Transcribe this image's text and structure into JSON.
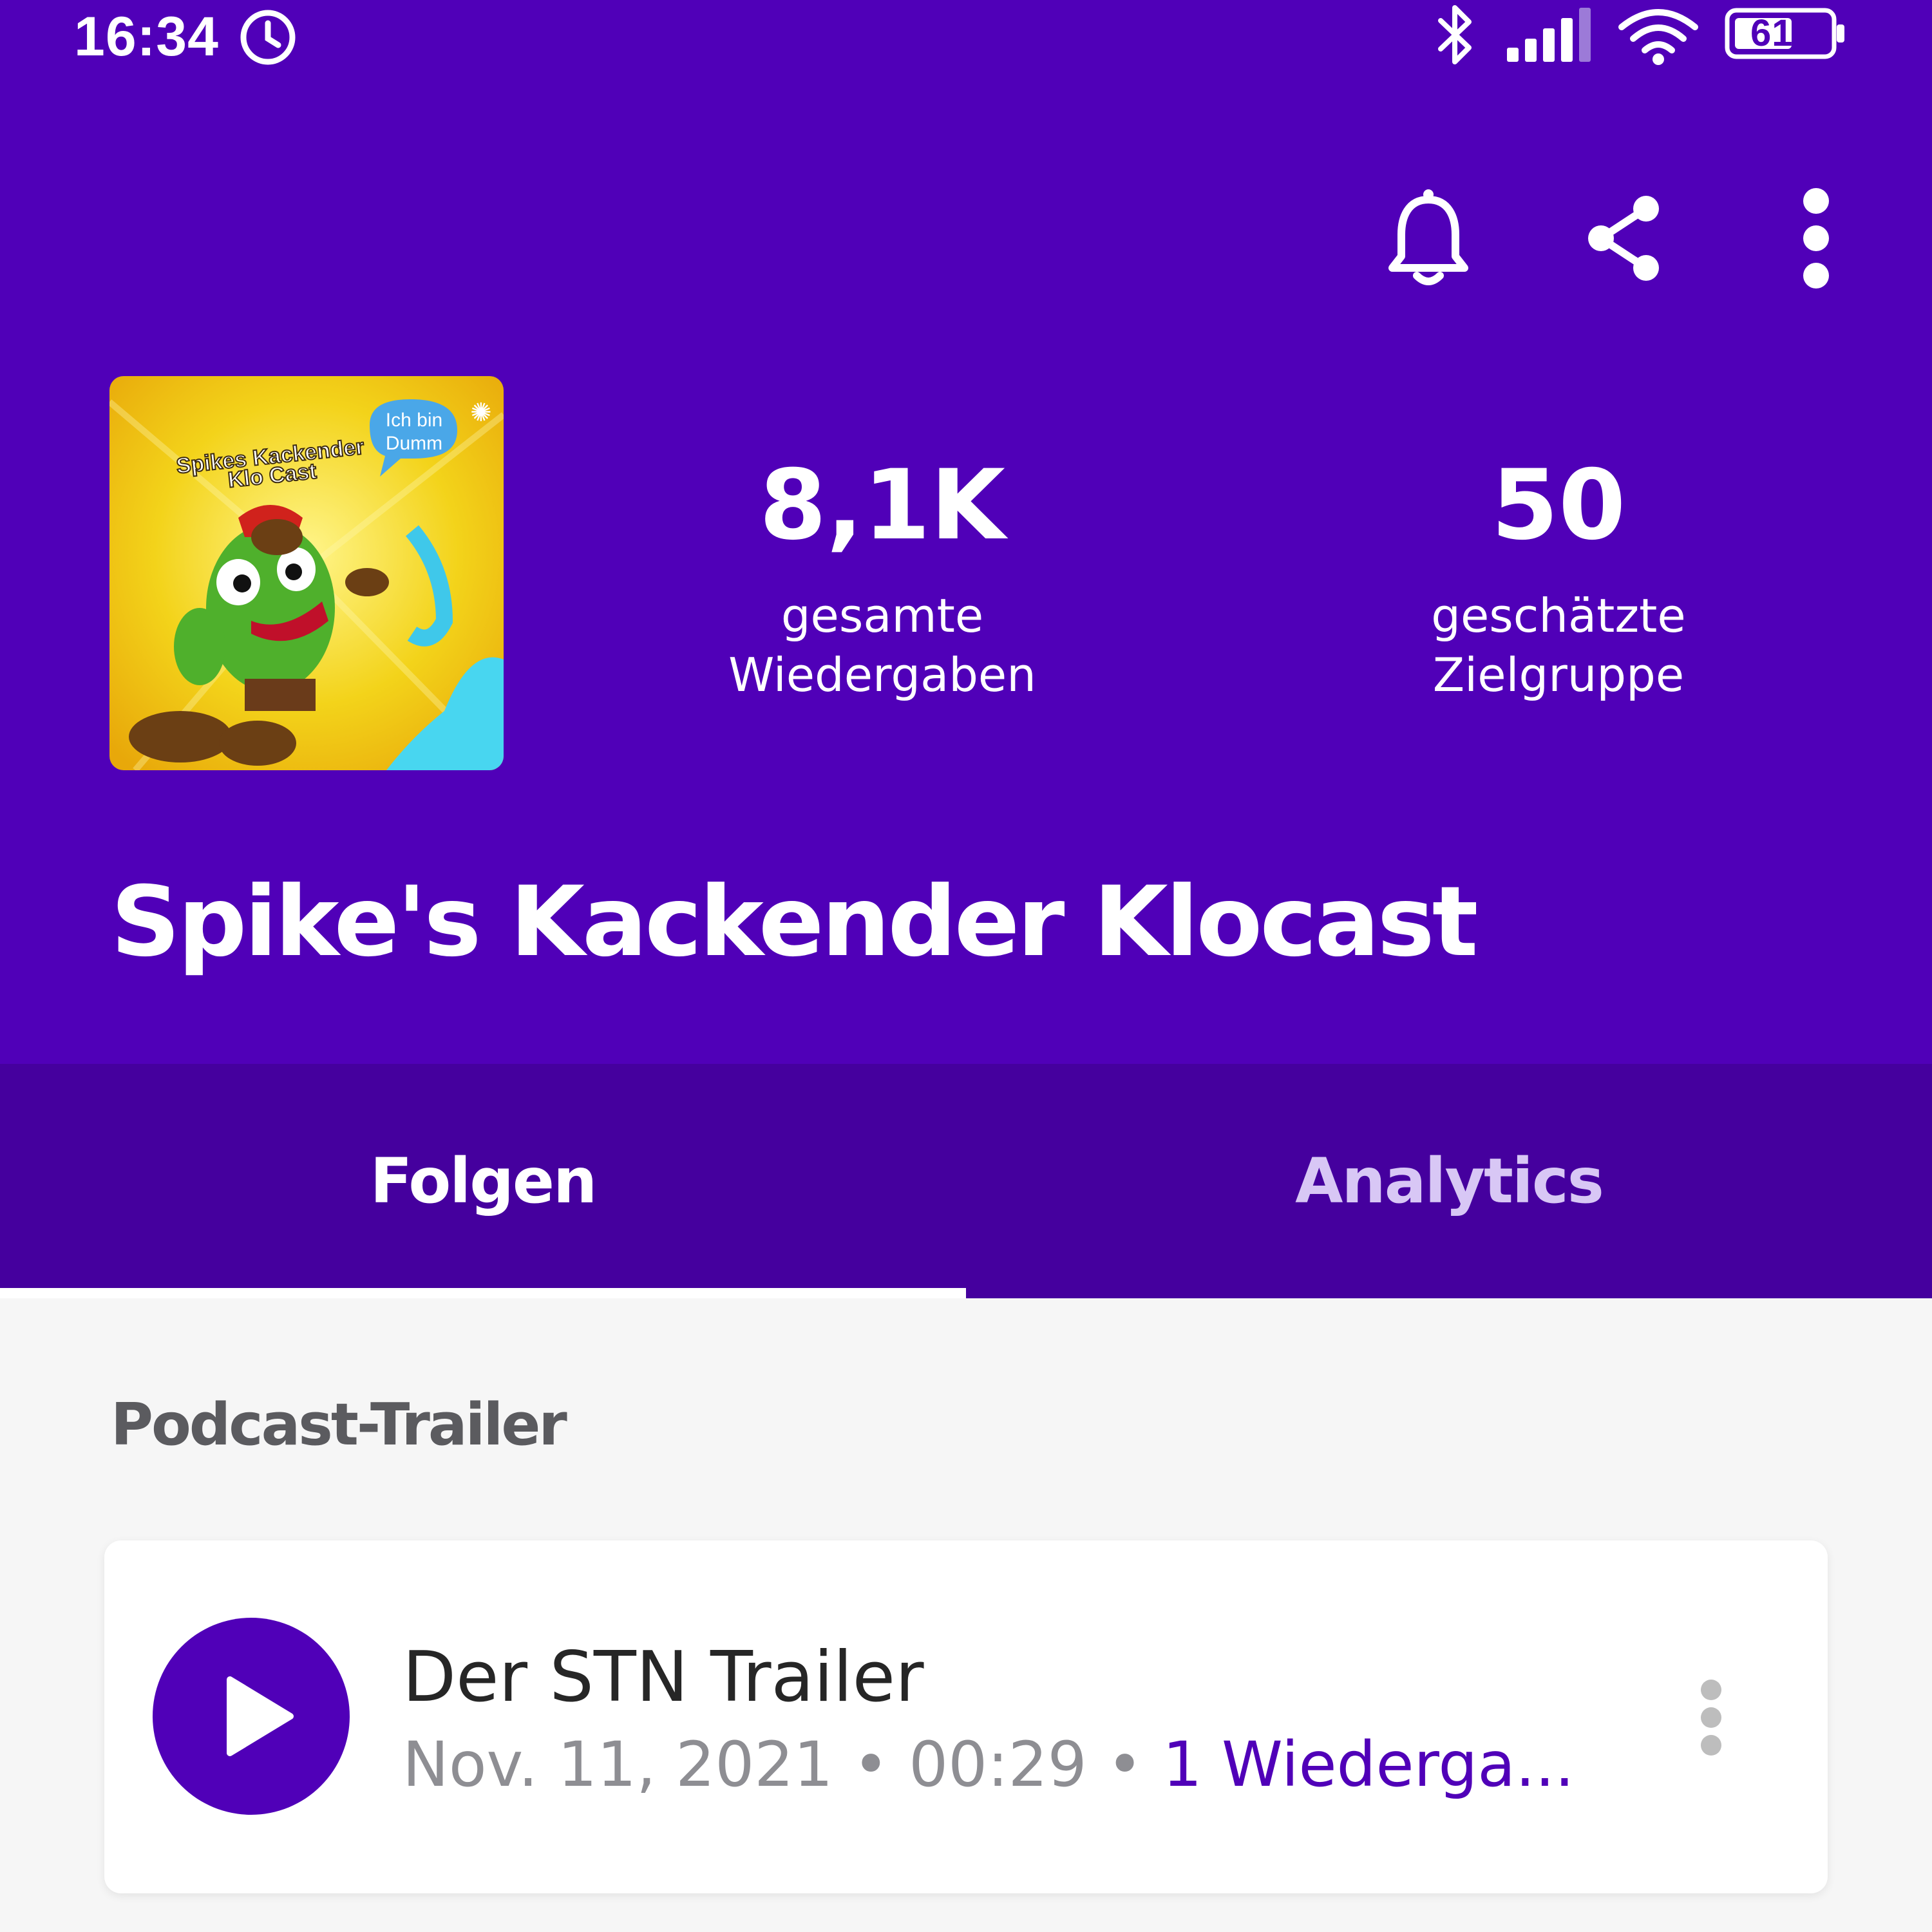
{
  "status_bar": {
    "time": "16:34",
    "battery": "61",
    "icons": [
      "alarm-icon",
      "bluetooth-icon",
      "signal-icon",
      "wifi-icon",
      "battery-icon"
    ]
  },
  "toolbar": {
    "icons": [
      "bell-icon",
      "share-icon",
      "more-vert-icon"
    ]
  },
  "podcast": {
    "cover_texts": [
      "Spikes Kackender",
      "Klo Cast",
      "Ich bin",
      "Dumm"
    ],
    "title": "Spike's Kackender Klocast",
    "stats": {
      "plays_value": "8,1K",
      "plays_label_1": "gesamte",
      "plays_label_2": "Wiedergaben",
      "audience_value": "50",
      "audience_label_1": "geschätzte",
      "audience_label_2": "Zielgruppe"
    }
  },
  "tabs": [
    {
      "label": "Folgen",
      "active": true
    },
    {
      "label": "Analytics",
      "active": false
    }
  ],
  "trailer_section": {
    "heading": "Podcast-Trailer",
    "episode": {
      "title": "Der STN Trailer",
      "date": "Nov. 11, 2021",
      "separator": " • ",
      "duration": "00:29",
      "plays": "1 Wiederga..."
    }
  },
  "colors": {
    "brand_purple": "#5000b8",
    "tab_bar": "#45009e",
    "background": "#f6f6f6"
  }
}
